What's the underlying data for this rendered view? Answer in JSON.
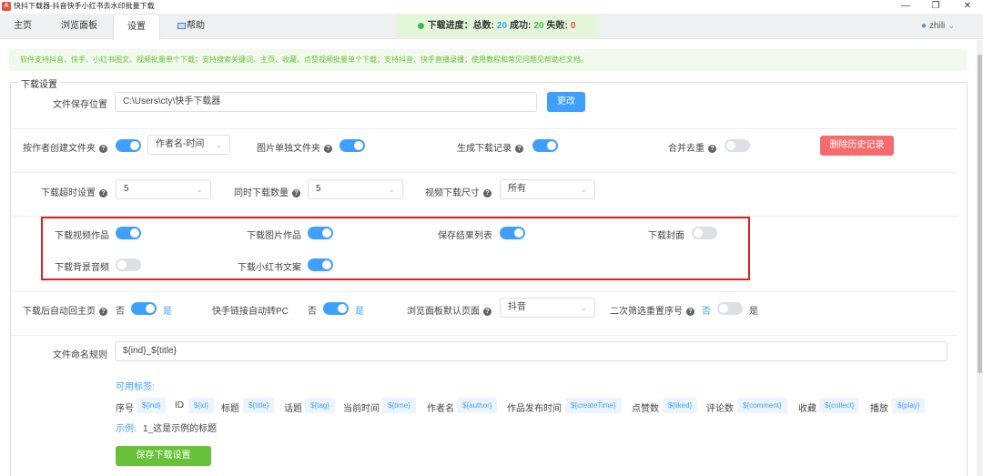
{
  "window": {
    "title": "快抖下载器-抖音快手小红书去水印批量下载",
    "app_icon": "A",
    "minimize": "—",
    "maximize": "❐",
    "close": "✕"
  },
  "tabs": [
    {
      "label": "主页"
    },
    {
      "label": "浏览面板"
    },
    {
      "label": "设置"
    },
    {
      "label": "帮助"
    }
  ],
  "progress": {
    "label": "下载进度：",
    "total_label": "总数:",
    "total": "20",
    "success_label": "成功:",
    "success": "20",
    "fail_label": "失败:",
    "fail": "0"
  },
  "user": {
    "name": "zhili"
  },
  "notice": "软件支持抖音、快手、小红书图文、视频批量单个下载；支持搜索关键词、主页、收藏、点赞视频批量单个下载；支持抖音、快手直播录播；使用教程和常见问题见帮助栏文档。",
  "settings": {
    "legend": "下载设置",
    "save_path": {
      "label": "文件保存位置",
      "value": "C:\\Users\\cty\\快手下载器",
      "button": "更改"
    },
    "row2": {
      "author_folder": {
        "label": "按作者创建文件夹",
        "on": true,
        "select": "作者名-时间"
      },
      "image_folder": {
        "label": "图片单独文件夹",
        "on": true
      },
      "record": {
        "label": "生成下载记录",
        "on": true
      },
      "dedupe": {
        "label": "合并去重",
        "on": false
      },
      "clear_button": "删除历史记录"
    },
    "row3": {
      "timeout": {
        "label": "下载超时设置",
        "value": "5"
      },
      "concurrent": {
        "label": "同时下载数量",
        "value": "5"
      },
      "video_size": {
        "label": "视频下载尺寸",
        "value": "所有"
      }
    },
    "content": {
      "video": {
        "label": "下载视频作品",
        "on": true
      },
      "images": {
        "label": "下载图片作品",
        "on": true
      },
      "result_list": {
        "label": "保存结果列表",
        "on": true
      },
      "cover": {
        "label": "下载封面",
        "on": false
      },
      "bgm": {
        "label": "下载背景音频",
        "on": false
      },
      "xhs_text": {
        "label": "下载小红书文案",
        "on": true
      }
    },
    "row5": {
      "back_home": {
        "label": "下载后自动回主页",
        "off_text": "否",
        "on_text": "是",
        "on": true
      },
      "ks_pc": {
        "label": "快手链接自动转PC",
        "off_text": "否",
        "on_text": "是",
        "on": true
      },
      "default_page": {
        "label": "浏览面板默认页面",
        "value": "抖音"
      },
      "reseq": {
        "label": "二次筛选重置序号",
        "off_text": "否",
        "on_text": "是",
        "on": false
      }
    },
    "naming": {
      "label": "文件命名规则",
      "value": "${ind}_${title}",
      "tags_title": "可用标签:",
      "tags": [
        {
          "name": "序号",
          "tag": "${ind}"
        },
        {
          "name": "ID",
          "tag": "${id}"
        },
        {
          "name": "标题",
          "tag": "${title}"
        },
        {
          "name": "话题",
          "tag": "${tag}"
        },
        {
          "name": "当前时间",
          "tag": "${time}"
        },
        {
          "name": "作者名",
          "tag": "${author}"
        },
        {
          "name": "作品发布时间",
          "tag": "${createTime}"
        },
        {
          "name": "点赞数",
          "tag": "${liked}"
        },
        {
          "name": "评论数",
          "tag": "${comment}"
        },
        {
          "name": "收藏",
          "tag": "${collect}"
        },
        {
          "name": "播放",
          "tag": "${play}"
        }
      ],
      "example_label": "示例:",
      "example_value": "1_这是示例的标题"
    },
    "save_button": "保存下载设置"
  },
  "colors": {
    "accent": "#409eff",
    "success": "#67c23a",
    "danger": "#f56c6c",
    "highlight_box": "#e02020"
  }
}
